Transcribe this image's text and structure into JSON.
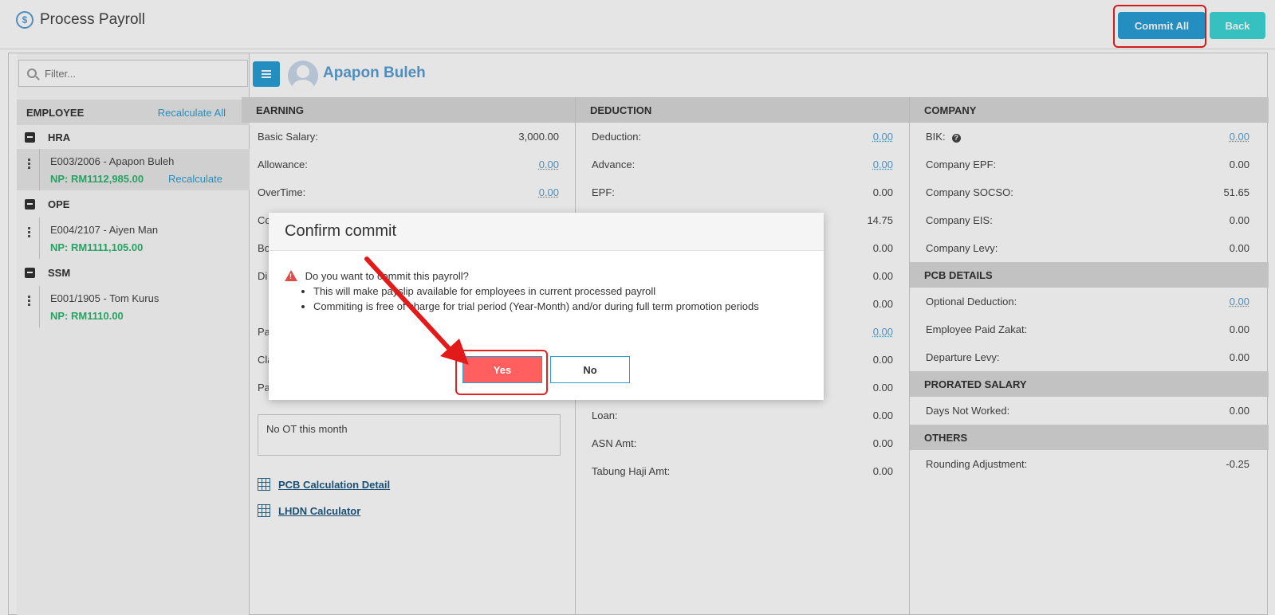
{
  "app": {
    "page_title": "Process Payroll",
    "commit_all_label": "Commit All",
    "back_label": "Back"
  },
  "sidebar": {
    "filter_placeholder": "Filter...",
    "header_label": "EMPLOYEE",
    "recalculate_all_label": "Recalculate All",
    "groups": [
      {
        "name": "HRA",
        "employees": [
          {
            "name": "E003/2006 - Apapon Buleh",
            "np": "NP: RM1112,985.00",
            "action": "Recalculate"
          }
        ]
      },
      {
        "name": "OPE",
        "employees": [
          {
            "name": "E004/2107 - Aiyen Man",
            "np": "NP: RM1111,105.00"
          }
        ]
      },
      {
        "name": "SSM",
        "employees": [
          {
            "name": "E001/1905 - Tom Kurus",
            "np": "NP: RM1110.00"
          }
        ]
      }
    ]
  },
  "employee": {
    "name": "Apapon Buleh"
  },
  "earning": {
    "title": "EARNING",
    "rows": [
      {
        "label": "Basic Salary:",
        "value": "3,000.00"
      },
      {
        "label": "Allowance:",
        "value": "0.00"
      },
      {
        "label": "OverTime:",
        "value": "0.00"
      },
      {
        "label": "Co",
        "value": ""
      },
      {
        "label": "Bo",
        "value": ""
      },
      {
        "label": "Di",
        "value": ""
      },
      {
        "label": "",
        "value": ""
      },
      {
        "label": "Pa",
        "value": ""
      },
      {
        "label": "Cla",
        "value": ""
      },
      {
        "label": "Pa",
        "value": ""
      }
    ],
    "ot_note": "No OT this month",
    "links": [
      "PCB Calculation Detail",
      "LHDN Calculator"
    ]
  },
  "deduction": {
    "title": "DEDUCTION",
    "rows": [
      {
        "label": "Deduction:",
        "value": "0.00"
      },
      {
        "label": "Advance:",
        "value": "0.00"
      },
      {
        "label": "EPF:",
        "value": "0.00"
      },
      {
        "label": "",
        "value": "14.75"
      },
      {
        "label": "",
        "value": "0.00"
      },
      {
        "label": "",
        "value": "0.00"
      },
      {
        "label": "",
        "value": "0.00"
      },
      {
        "label": "",
        "value": "0.00"
      },
      {
        "label": "",
        "value": "0.00"
      },
      {
        "label": "",
        "value": "0.00"
      },
      {
        "label": "Loan:",
        "value": "0.00"
      },
      {
        "label": "ASN Amt:",
        "value": "0.00"
      },
      {
        "label": "Tabung Haji Amt:",
        "value": "0.00"
      }
    ]
  },
  "company": {
    "title": "COMPANY",
    "rows": [
      {
        "label": "BIK:",
        "value": "0.00"
      },
      {
        "label": "Company EPF:",
        "value": "0.00"
      },
      {
        "label": "Company SOCSO:",
        "value": "51.65"
      },
      {
        "label": "Company EIS:",
        "value": "0.00"
      },
      {
        "label": "Company Levy:",
        "value": "0.00"
      }
    ],
    "pcb_title": "PCB DETAILS",
    "pcb_rows": [
      {
        "label": "Optional Deduction:",
        "value": "0.00"
      },
      {
        "label": "Employee Paid Zakat:",
        "value": "0.00"
      },
      {
        "label": "Departure Levy:",
        "value": "0.00"
      }
    ],
    "prorated_title": "PRORATED SALARY",
    "prorated_rows": [
      {
        "label": "Days Not Worked:",
        "value": "0.00"
      }
    ],
    "others_title": "OTHERS",
    "others_rows": [
      {
        "label": "Rounding Adjustment:",
        "value": "-0.25"
      }
    ]
  },
  "modal": {
    "title": "Confirm commit",
    "question": "Do you want to commit this payroll?",
    "bullets": [
      "This will make payslip available for employees in current processed payroll",
      "Commiting is free of charge for trial period (Year-Month) and/or during full term promotion periods"
    ],
    "yes_label": "Yes",
    "no_label": "No"
  },
  "colors": {
    "primary": "#2a9fd6",
    "back": "#3ed6d6",
    "yes": "#ff5f5f",
    "np_green": "#2cb56e",
    "highlight": "#e82020"
  },
  "icons": [
    "payroll-icon",
    "search-icon",
    "minus-icon",
    "kebab-icon",
    "hamburger-icon",
    "avatar",
    "help-icon",
    "calculator-icon",
    "warning-icon",
    "arrow-annotation"
  ]
}
